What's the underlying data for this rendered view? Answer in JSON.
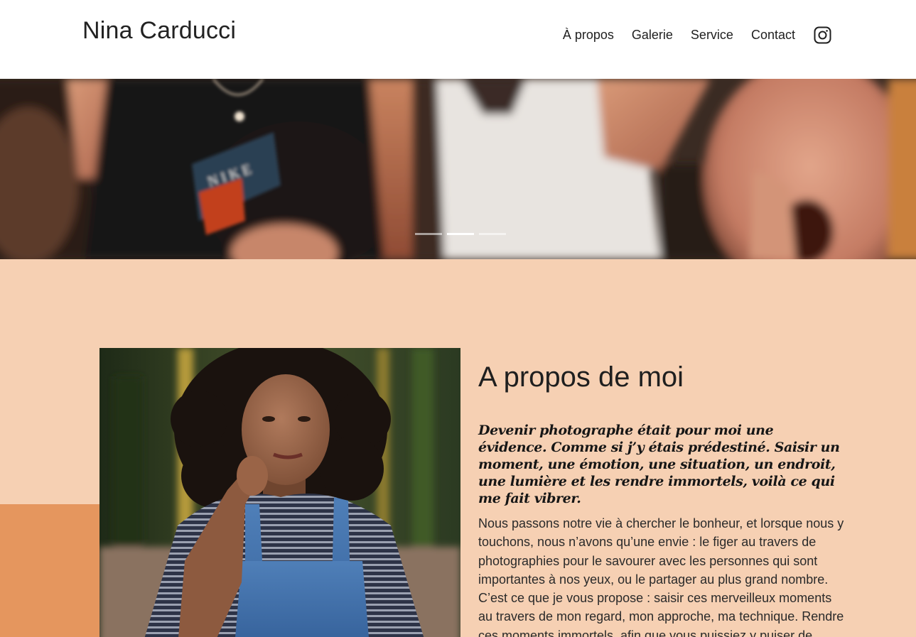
{
  "header": {
    "brand": "Nina Carducci",
    "nav": [
      {
        "label": "À propos"
      },
      {
        "label": "Galerie"
      },
      {
        "label": "Service"
      },
      {
        "label": "Contact"
      }
    ],
    "social_icon": "instagram-icon"
  },
  "hero": {
    "slides": 3,
    "active_slide": 2,
    "image_description_icon": "concert-crowd-photo"
  },
  "about": {
    "title": "A propos de moi",
    "lead": "Devenir photographe était pour moi une évidence. Comme si j’y étais prédestiné. Saisir un moment, une émotion, une situation, un endroit, une lumière et les rendre immortels, voilà ce qui me fait vibrer.",
    "body": "Nous passons notre vie à chercher le bonheur, et lorsque nous y touchons, nous n’avons qu’une envie : le figer au travers de photographies pour le savourer avec les personnes qui sont importantes à nos yeux, ou le partager au plus grand nombre. C’est ce que je vous propose : saisir ces merveilleux moments au travers de mon regard, mon approche, ma technique. Rendre ces moments immortels, afin que vous puissiez y puiser de l’amour, du bonheur, de la",
    "portrait_icon": "portrait-photo"
  },
  "colors": {
    "section_bg": "#f6d0b3",
    "accent": "#e5965e",
    "text": "#1f1f1f"
  }
}
